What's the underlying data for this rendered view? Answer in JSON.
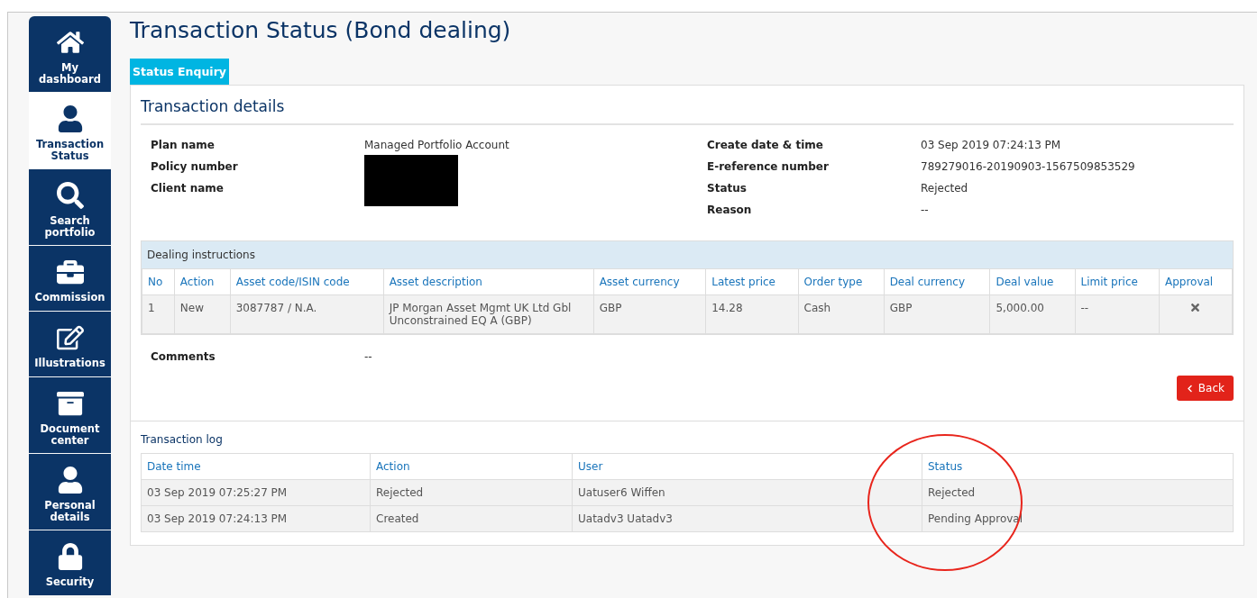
{
  "sidebar": {
    "items": [
      {
        "label": "My dashboard",
        "selected": false
      },
      {
        "label": "Transaction Status",
        "selected": true
      },
      {
        "label": "Search portfolio",
        "selected": false
      },
      {
        "label": "Commission",
        "selected": false
      },
      {
        "label": "Illustrations",
        "selected": false
      },
      {
        "label": "Document center",
        "selected": false
      },
      {
        "label": "Personal details",
        "selected": false
      },
      {
        "label": "Security",
        "selected": false
      }
    ]
  },
  "page_title": "Transaction Status (Bond dealing)",
  "tabs": [
    {
      "label": "Status Enquiry",
      "selected": true
    }
  ],
  "details": {
    "title": "Transaction details",
    "left": [
      {
        "label": "Plan name",
        "kind": "text",
        "value": "Managed Portfolio Account"
      },
      {
        "label": "Policy number",
        "kind": "redacted"
      },
      {
        "label": "Client name",
        "kind": "redacted"
      }
    ],
    "right": [
      {
        "label": "Create date & time",
        "kind": "text",
        "value": "03 Sep 2019 07:24:13 PM"
      },
      {
        "label": "E-reference number",
        "kind": "text",
        "value": "789279016-20190903-1567509853529"
      },
      {
        "label": "Status",
        "kind": "text",
        "value": "Rejected"
      },
      {
        "label": "Reason",
        "kind": "text",
        "value": "--"
      }
    ]
  },
  "dealing_instructions": {
    "title": "Dealing instructions",
    "columns": [
      "No",
      "Action",
      "Asset code/ISIN code",
      "Asset description",
      "Asset currency",
      "Latest price",
      "Order type",
      "Deal currency",
      "Deal value",
      "Limit price",
      "Approval"
    ],
    "rows": [
      {
        "cells": [
          "1",
          "New",
          "3087787 / N.A.",
          "JP Morgan Asset Mgmt UK Ltd Gbl Unconstrained EQ A (GBP)",
          "GBP",
          "14.28",
          "Cash",
          "GBP",
          "5,000.00",
          "--"
        ],
        "approved": false
      }
    ]
  },
  "comments": {
    "label": "Comments",
    "value": "--"
  },
  "back_button": {
    "label": "Back"
  },
  "transaction_log": {
    "title": "Transaction log",
    "columns": [
      "Date time",
      "Action",
      "User",
      "Status"
    ],
    "rows": [
      [
        "03 Sep 2019 07:25:27 PM",
        "Rejected",
        "Uatuser6 Wiffen",
        "Rejected"
      ],
      [
        "03 Sep 2019 07:24:13 PM",
        "Created",
        "Uatadv3 Uatadv3",
        "Pending Approval"
      ]
    ]
  }
}
